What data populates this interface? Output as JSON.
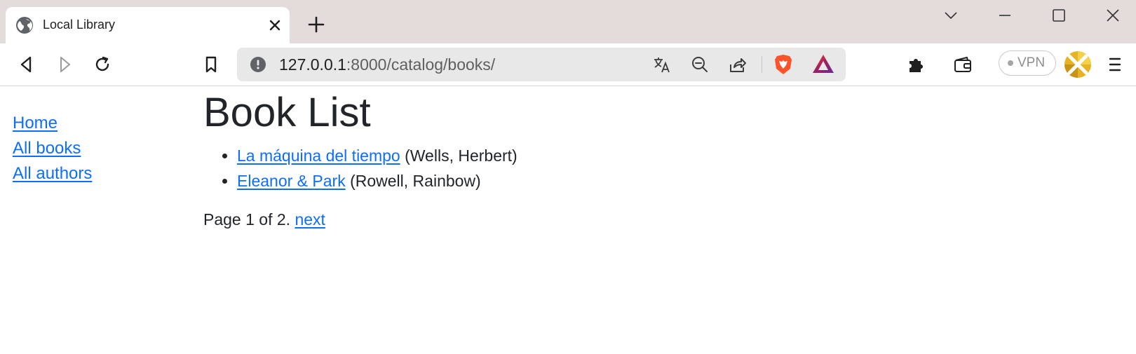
{
  "browser": {
    "tab": {
      "title": "Local Library",
      "favicon": "globe-icon"
    },
    "window_controls": [
      "chevron-down-icon",
      "minimize-icon",
      "maximize-icon",
      "close-icon"
    ],
    "toolbar": {
      "address": {
        "host": "127.0.0.1",
        "path": ":8000/catalog/books/"
      },
      "vpn_label": "VPN"
    }
  },
  "sidebar": {
    "items": [
      {
        "label": "Home"
      },
      {
        "label": "All books"
      },
      {
        "label": "All authors"
      }
    ]
  },
  "main": {
    "title": "Book List",
    "books": [
      {
        "title": "La máquina del tiempo",
        "author": "(Wells, Herbert)"
      },
      {
        "title": "Eleanor & Park",
        "author": "(Rowell, Rainbow)"
      }
    ],
    "pagination": {
      "text": "Page 1 of 2.",
      "next_label": "next"
    }
  },
  "colors": {
    "link": "#0d6efd",
    "text": "#212529",
    "tabstrip": "#e3dcda",
    "omnibox": "#e8e8e8",
    "brave_orange": "#fb542b"
  }
}
